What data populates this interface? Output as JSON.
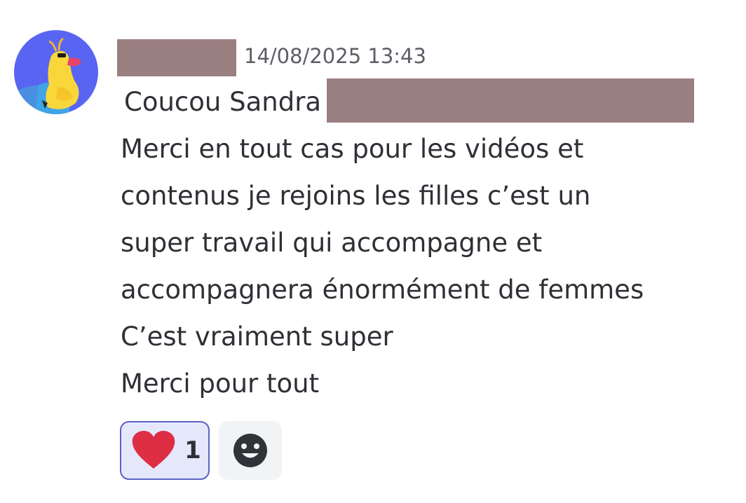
{
  "message": {
    "timestamp": "14/08/2025 13:43",
    "lines": [
      "Coucou Sandra",
      "Merci en tout cas pour les vidéos et",
      "contenus je rejoins les filles c’est un",
      "super travail qui accompagne et",
      "accompagnera énormément de femmes",
      "C’est vraiment super",
      "Merci pour tout"
    ]
  },
  "reactions": [
    {
      "icon": "red-heart-icon",
      "count": "1",
      "selected": true
    }
  ],
  "add_reaction": {
    "icon": "smiley-face-icon"
  },
  "avatar": {
    "icon": "yellow-duck-avatar"
  },
  "colors": {
    "redaction": "#9a7f81",
    "text": "#2e3035",
    "timestamp": "#5c5e66",
    "reaction_bg": "#e5e7fb",
    "reaction_border": "#5b62c4",
    "heart": "#dd2e44",
    "avatar_bg": "#5865f2"
  }
}
